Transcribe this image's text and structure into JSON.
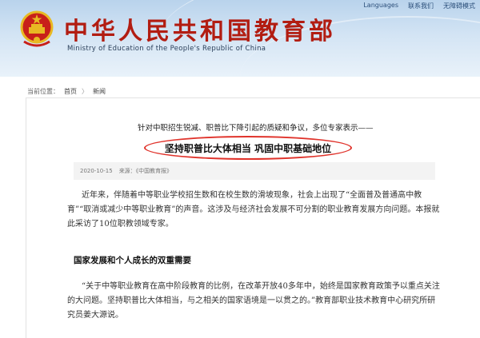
{
  "header": {
    "top_links": [
      "Languages",
      "联系我们",
      "无障碍模式"
    ],
    "title": "中华人民共和国教育部",
    "subtitle": "Ministry of Education of the People's Republic of China",
    "emblem_icon": "national-emblem-icon",
    "colors": {
      "title": "#b21d12",
      "banner": "#c9dcf0"
    }
  },
  "breadcrumb": {
    "label": "当前位置：",
    "home": "首页",
    "sep": "〉",
    "current": "新闻"
  },
  "article": {
    "pre_headline": "针对中职招生锐减、职普比下降引起的质疑和争议，多位专家表示——",
    "title": "坚持职普比大体相当 巩固中职基础地位",
    "date": "2020-10-15",
    "source": "来源：《中国教育报》",
    "para1": "近年来，伴随着中等职业学校招生数和在校生数的滑坡现象，社会上出现了“全面普及普通高中教育”“取消或减少中等职业教育”的声音。这涉及与经济社会发展不可分割的职业教育发展方向问题。本报就此采访了10位职教领域专家。",
    "section_head": "国家发展和个人成长的双重需要",
    "para2": "“关于中等职业教育在高中阶段教育的比例，在改革开放40多年中，始终是国家教育政策予以重点关注的大问题。坚持职普比大体相当，与之相关的国家语境是一以贯之的。”教育部职业技术教育中心研究所研究员姜大源说。",
    "highlight_color": "#e0332b"
  }
}
